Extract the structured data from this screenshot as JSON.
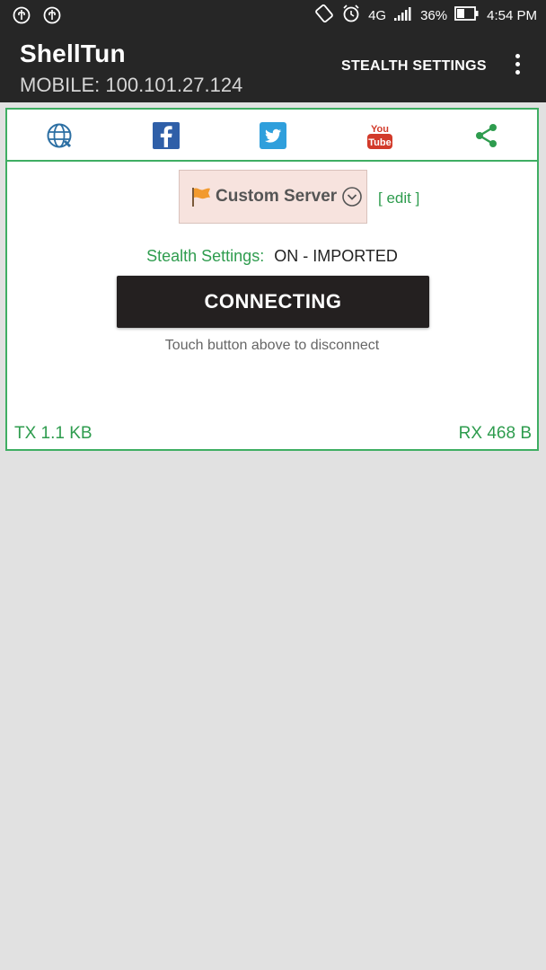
{
  "status_bar": {
    "signal": "4G",
    "battery": "36%",
    "time": "4:54 PM",
    "icons": [
      "usb-icon",
      "usb-icon",
      "screen-rotate-icon",
      "alarm-icon",
      "signal-icon",
      "battery-icon"
    ]
  },
  "app_bar": {
    "title": "ShellTun",
    "subtitle": "MOBILE: 100.101.27.124",
    "stealth_settings_label": "STEALTH SETTINGS",
    "overflow_icon": "overflow-menu-icon"
  },
  "social": {
    "icons": [
      "globe-icon",
      "facebook-icon",
      "twitter-icon",
      "youtube-icon",
      "share-icon"
    ]
  },
  "server": {
    "label": "Custom Server",
    "flag_icon": "flag-icon",
    "dropdown_icon": "chevron-down-icon",
    "edit_label": "[ edit ]"
  },
  "stealth": {
    "label": "Stealth Settings:",
    "value": "ON - IMPORTED"
  },
  "connect_button": {
    "label": "CONNECTING",
    "hint": "Touch button above to disconnect"
  },
  "traffic": {
    "tx": "TX 1.1 KB",
    "rx": "RX 468 B"
  },
  "colors": {
    "accent_green": "#2e9c4e",
    "bar_bg": "#262626",
    "page_bg": "#e1e1e1",
    "button_bg": "#242020"
  }
}
